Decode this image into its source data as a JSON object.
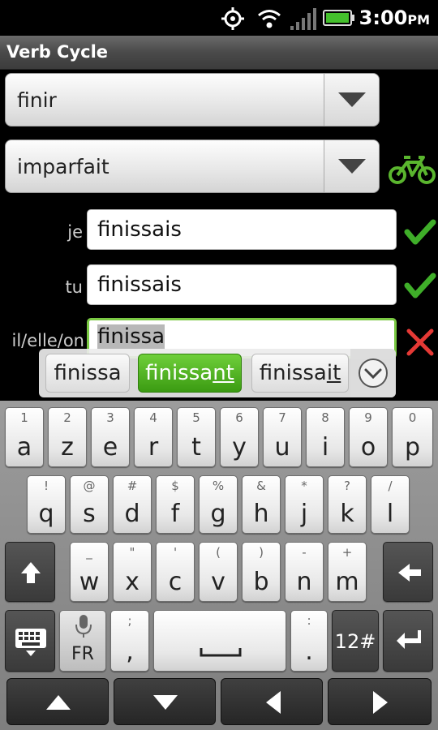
{
  "status": {
    "time": "3:00",
    "ampm": "PM"
  },
  "app": {
    "title": "Verb Cycle"
  },
  "verb_spinner": {
    "value": "finir"
  },
  "tense_spinner": {
    "value": "imparfait"
  },
  "rows": [
    {
      "pronoun": "je",
      "value": "finissais",
      "status": "correct"
    },
    {
      "pronoun": "tu",
      "value": "finissais",
      "status": "correct"
    },
    {
      "pronoun": "il/elle/on",
      "value": "finissa",
      "status": "wrong"
    }
  ],
  "suggestions": {
    "left": "finissa",
    "middle_prefix": "finissa",
    "middle_underlined": "nt",
    "right_prefix": "finissa",
    "right_underlined": "it"
  },
  "keyboard": {
    "row1": [
      {
        "main": "a",
        "sub": "1"
      },
      {
        "main": "z",
        "sub": "2"
      },
      {
        "main": "e",
        "sub": "3"
      },
      {
        "main": "r",
        "sub": "4"
      },
      {
        "main": "t",
        "sub": "5"
      },
      {
        "main": "y",
        "sub": "6"
      },
      {
        "main": "u",
        "sub": "7"
      },
      {
        "main": "i",
        "sub": "8"
      },
      {
        "main": "o",
        "sub": "9"
      },
      {
        "main": "p",
        "sub": "0"
      }
    ],
    "row2": [
      {
        "main": "q",
        "sub": "!"
      },
      {
        "main": "s",
        "sub": "@"
      },
      {
        "main": "d",
        "sub": "#"
      },
      {
        "main": "f",
        "sub": "$"
      },
      {
        "main": "g",
        "sub": "%"
      },
      {
        "main": "h",
        "sub": "&"
      },
      {
        "main": "j",
        "sub": "*"
      },
      {
        "main": "k",
        "sub": "?"
      },
      {
        "main": "l",
        "sub": "/"
      }
    ],
    "row3": [
      {
        "main": "w",
        "sub": "_"
      },
      {
        "main": "x",
        "sub": "\""
      },
      {
        "main": "c",
        "sub": "'"
      },
      {
        "main": "v",
        "sub": "("
      },
      {
        "main": "b",
        "sub": ")"
      },
      {
        "main": "n",
        "sub": "-"
      },
      {
        "main": "m",
        "sub": "+"
      }
    ],
    "lang_label": "FR",
    "comma": {
      "main": ",",
      "sub": ";"
    },
    "period": {
      "main": ".",
      "sub": ":"
    },
    "symbols_label": "12#"
  },
  "icons": {
    "bike": "bicycle-icon",
    "check": "checkmark-icon",
    "wrong": "x-icon"
  },
  "colors": {
    "accent": "#7ac943",
    "correct": "#3fae29",
    "wrong": "#e53935"
  }
}
